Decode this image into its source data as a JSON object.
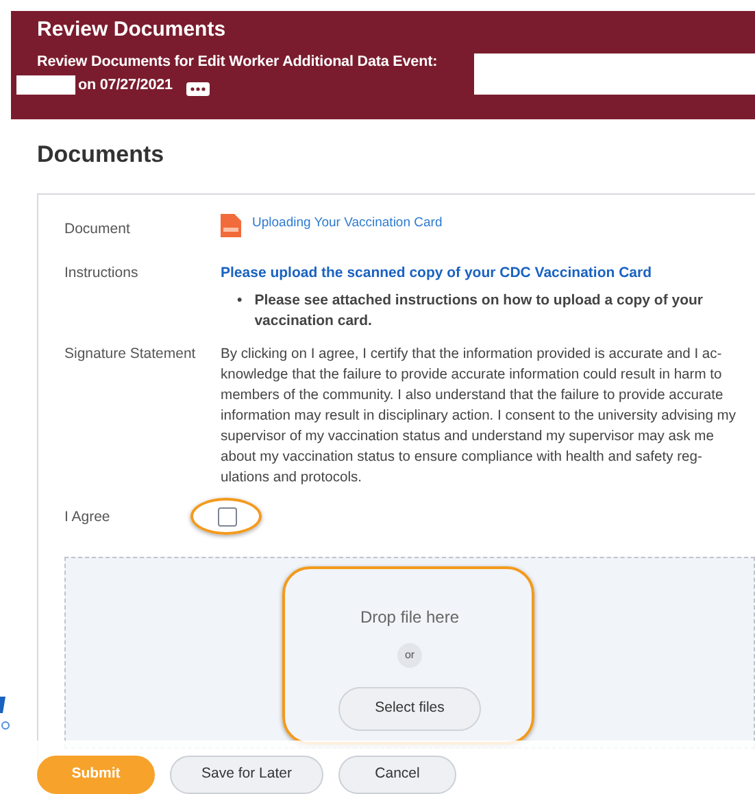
{
  "header": {
    "title": "Review Documents",
    "subtitle": "Review Documents for Edit Worker Additional Data Event:",
    "date_text": "on 07/27/2021"
  },
  "section_title": "Documents",
  "fields": [
    {
      "kind": "document",
      "label": "Document",
      "link": "Uploading Your Vaccination Card"
    },
    {
      "kind": "instructions",
      "label": "Instructions",
      "heading": "Please upload the scanned copy of your CDC Vaccination Card",
      "bullets": [
        {
          "marker": "•",
          "text": "Please see attached instructions on how to upload a copy of your vaccination card."
        }
      ]
    },
    {
      "kind": "text",
      "label": "Signature Statement",
      "text": "By clicking on I agree,  I certify that the information provided is accurate and I ac-knowledge that the failure to provide accurate information could result in harm to members of the community. I also understand that the failure to provide accurate information may result in disciplinary action. I consent to the university advising my supervisor of my vaccination status and understand my supervisor may ask me about my vaccination status to ensure compliance with health and safety reg-ulations and protocols."
    },
    {
      "kind": "checkbox",
      "label": "I Agree",
      "checked": false,
      "highlighted": true
    }
  ],
  "upload": {
    "prompt": "Drop file here",
    "separator": "or",
    "button": "Select files",
    "highlighted": true
  },
  "buttons": [
    {
      "label": "Submit",
      "primary": true
    },
    {
      "label": "Save for Later",
      "primary": false
    },
    {
      "label": "Cancel",
      "primary": false
    }
  ]
}
